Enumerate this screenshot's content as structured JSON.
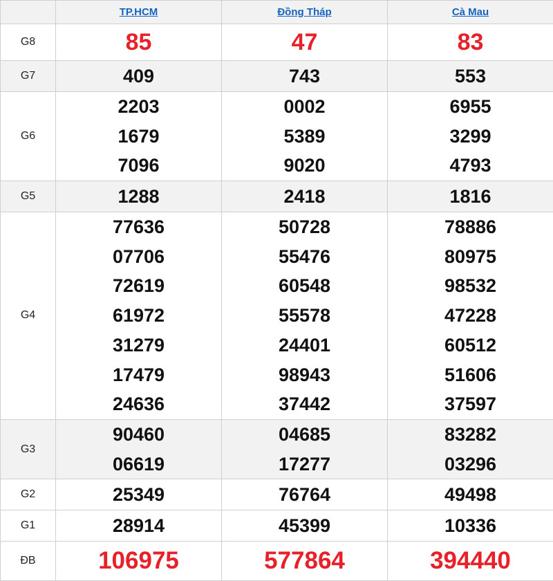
{
  "provinces": [
    "TP.HCM",
    "Đồng Tháp",
    "Cà Mau"
  ],
  "prizes": [
    {
      "label": "G8",
      "style": "red",
      "results": [
        [
          "85"
        ],
        [
          "47"
        ],
        [
          "83"
        ]
      ]
    },
    {
      "label": "G7",
      "style": "normal",
      "results": [
        [
          "409"
        ],
        [
          "743"
        ],
        [
          "553"
        ]
      ]
    },
    {
      "label": "G6",
      "style": "normal",
      "results": [
        [
          "2203",
          "1679",
          "7096"
        ],
        [
          "0002",
          "5389",
          "9020"
        ],
        [
          "6955",
          "3299",
          "4793"
        ]
      ]
    },
    {
      "label": "G5",
      "style": "normal",
      "results": [
        [
          "1288"
        ],
        [
          "2418"
        ],
        [
          "1816"
        ]
      ]
    },
    {
      "label": "G4",
      "style": "normal",
      "results": [
        [
          "77636",
          "07706",
          "72619",
          "61972",
          "31279",
          "17479",
          "24636"
        ],
        [
          "50728",
          "55476",
          "60548",
          "55578",
          "24401",
          "98943",
          "37442"
        ],
        [
          "78886",
          "80975",
          "98532",
          "47228",
          "60512",
          "51606",
          "37597"
        ]
      ]
    },
    {
      "label": "G3",
      "style": "normal",
      "results": [
        [
          "90460",
          "06619"
        ],
        [
          "04685",
          "17277"
        ],
        [
          "83282",
          "03296"
        ]
      ]
    },
    {
      "label": "G2",
      "style": "normal",
      "results": [
        [
          "25349"
        ],
        [
          "76764"
        ],
        [
          "49498"
        ]
      ]
    },
    {
      "label": "G1",
      "style": "normal",
      "results": [
        [
          "28914"
        ],
        [
          "45399"
        ],
        [
          "10336"
        ]
      ]
    },
    {
      "label": "ĐB",
      "style": "big",
      "results": [
        [
          "106975"
        ],
        [
          "577864"
        ],
        [
          "394440"
        ]
      ]
    }
  ],
  "colors": {
    "link": "#1565c0",
    "highlight": "#e8202a",
    "alt_row": "#f2f2f2",
    "border": "#cfcfcf"
  }
}
